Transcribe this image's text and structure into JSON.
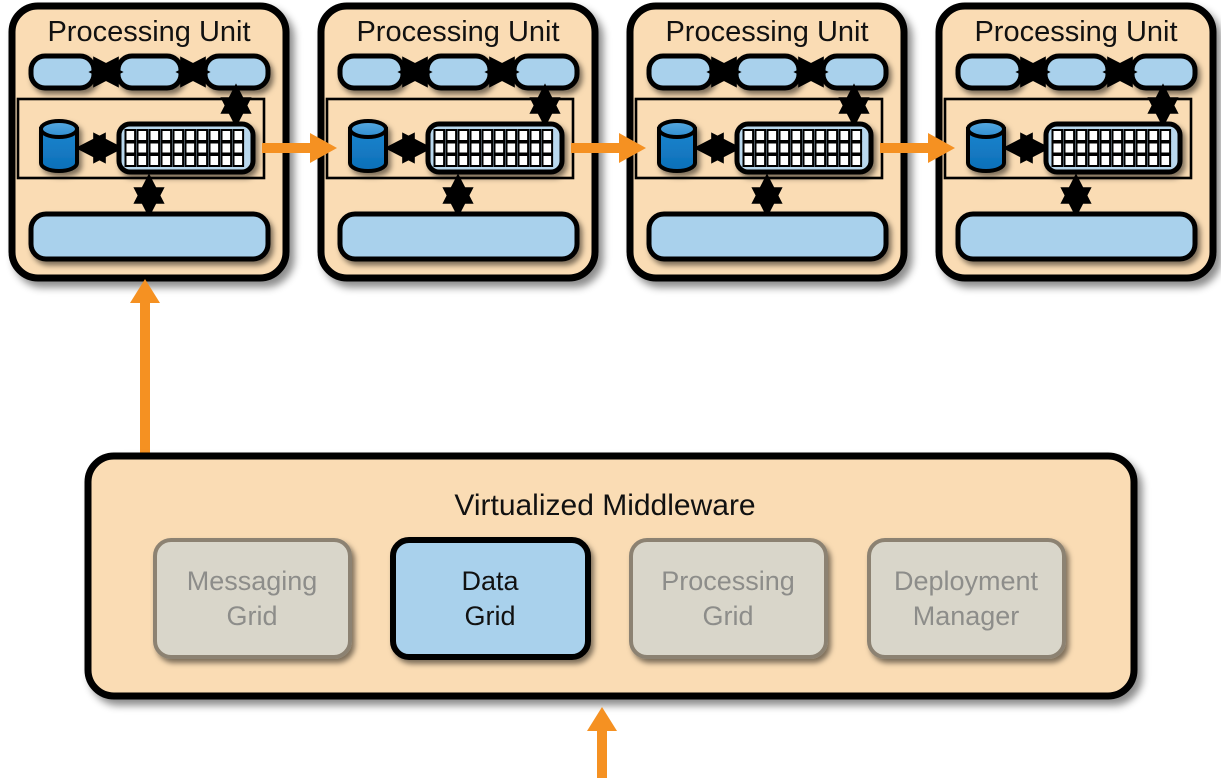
{
  "diagram": {
    "title_not_shown": "",
    "colors": {
      "panel_fill": "#fadcb4",
      "panel_stroke": "#000000",
      "component_blue": "#a9d1ec",
      "component_blue_stroke": "#000000",
      "db_cylinder_body": "#1177c4",
      "db_cylinder_top": "#3c97d8",
      "grid_cell": "#ffffff",
      "grid_frame": "#b9d8ee",
      "arrow_orange": "#f59122",
      "arrow_black": "#000000",
      "service_inactive_fill": "#d9d6ca",
      "service_inactive_stroke": "#8c8272",
      "service_inactive_text": "#8d8d8a",
      "service_active_fill": "#a9d1ec",
      "service_active_stroke": "#000000",
      "service_active_text": "#111111"
    }
  },
  "processing_units": [
    {
      "title": "Processing Unit"
    },
    {
      "title": "Processing Unit"
    },
    {
      "title": "Processing Unit"
    },
    {
      "title": "Processing Unit"
    }
  ],
  "processing_unit_internals": {
    "top_row_node_count": 3,
    "grid_columns": 10,
    "grid_rows": 3,
    "has_database_cylinder": true,
    "has_bottom_bar": true,
    "inner_frame": true
  },
  "middleware": {
    "title": "Virtualized Middleware",
    "services": [
      {
        "label_line1": "Messaging",
        "label_line2": "Grid",
        "state": "inactive"
      },
      {
        "label_line1": "Data",
        "label_line2": "Grid",
        "state": "active"
      },
      {
        "label_line1": "Processing",
        "label_line2": "Grid",
        "state": "inactive"
      },
      {
        "label_line1": "Deployment",
        "label_line2": "Manager",
        "state": "inactive"
      }
    ]
  },
  "connectors": {
    "unit_to_unit_count": 3,
    "middleware_to_unit_label": "",
    "bottom_inbound_label": ""
  }
}
